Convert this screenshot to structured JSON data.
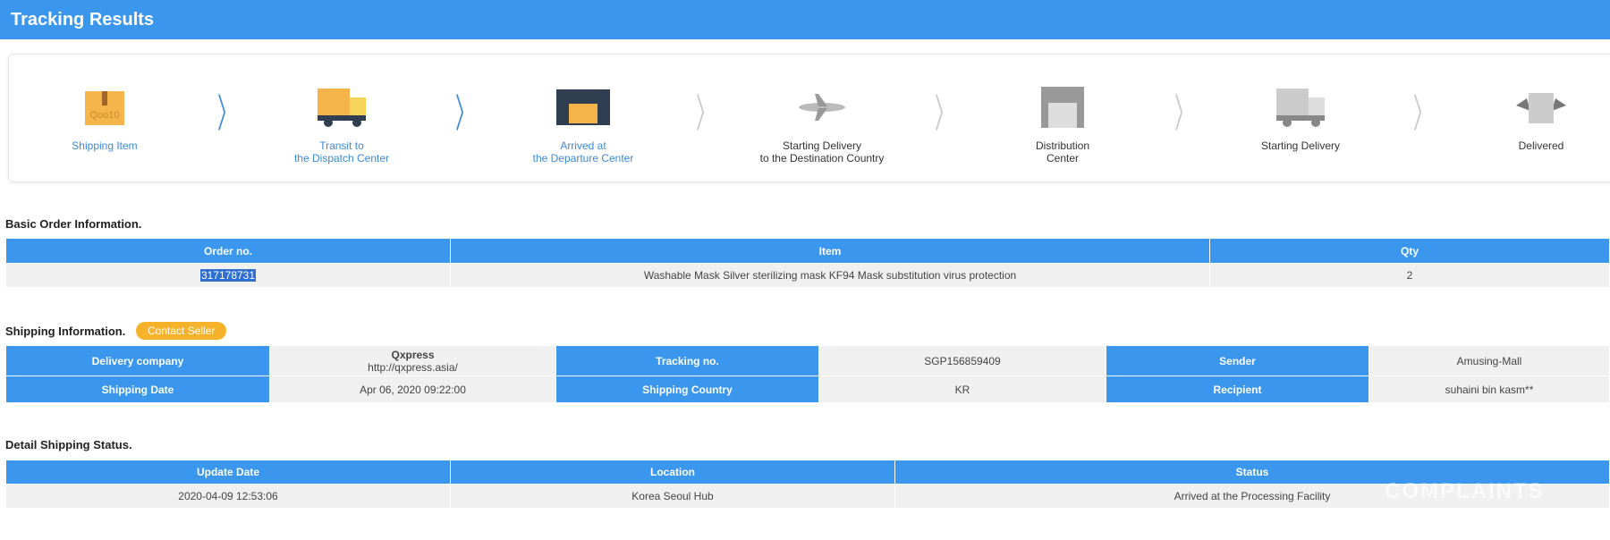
{
  "header": {
    "title": "Tracking Results"
  },
  "steps": [
    {
      "label1": "Shipping Item",
      "label2": "",
      "icon": "box-icon"
    },
    {
      "label1": "Transit to",
      "label2": "the Dispatch Center",
      "icon": "truck-box-icon"
    },
    {
      "label1": "Arrived at",
      "label2": "the Departure Center",
      "icon": "warehouse-icon"
    },
    {
      "label1": "Starting Delivery",
      "label2": "to the Destination Country",
      "icon": "airplane-icon"
    },
    {
      "label1": "Distribution",
      "label2": "Center",
      "icon": "distribution-center-icon"
    },
    {
      "label1": "Starting Delivery",
      "label2": "",
      "icon": "delivery-truck-icon"
    },
    {
      "label1": "Delivered",
      "label2": "",
      "icon": "delivered-box-icon"
    }
  ],
  "completed_steps": 3,
  "basic": {
    "title": "Basic Order Information.",
    "headers": [
      "Order no.",
      "Item",
      "Qty"
    ],
    "row": [
      "317178731",
      "Washable Mask Silver sterilizing mask KF94 Mask substitution virus protection",
      "2"
    ]
  },
  "shipping": {
    "title": "Shipping Information.",
    "contact_seller": "Contact Seller",
    "delivery_company_label": "Delivery company",
    "delivery_company": "Qxpress",
    "delivery_company_url": "http://qxpress.asia/",
    "tracking_label": "Tracking no.",
    "tracking": "SGP156859409",
    "sender_label": "Sender",
    "sender": "Amusing-Mall",
    "date_label": "Shipping Date",
    "date": "Apr 06, 2020 09:22:00",
    "country_label": "Shipping Country",
    "country": "KR",
    "recipient_label": "Recipient",
    "recipient": "suhaini bin kasm**"
  },
  "detail": {
    "title": "Detail Shipping Status.",
    "headers": [
      "Update Date",
      "Location",
      "Status"
    ],
    "row": [
      "2020-04-09 12:53:06",
      "Korea Seoul Hub",
      "Arrived at the Processing Facility"
    ]
  },
  "watermark": "COMPLAINTS"
}
